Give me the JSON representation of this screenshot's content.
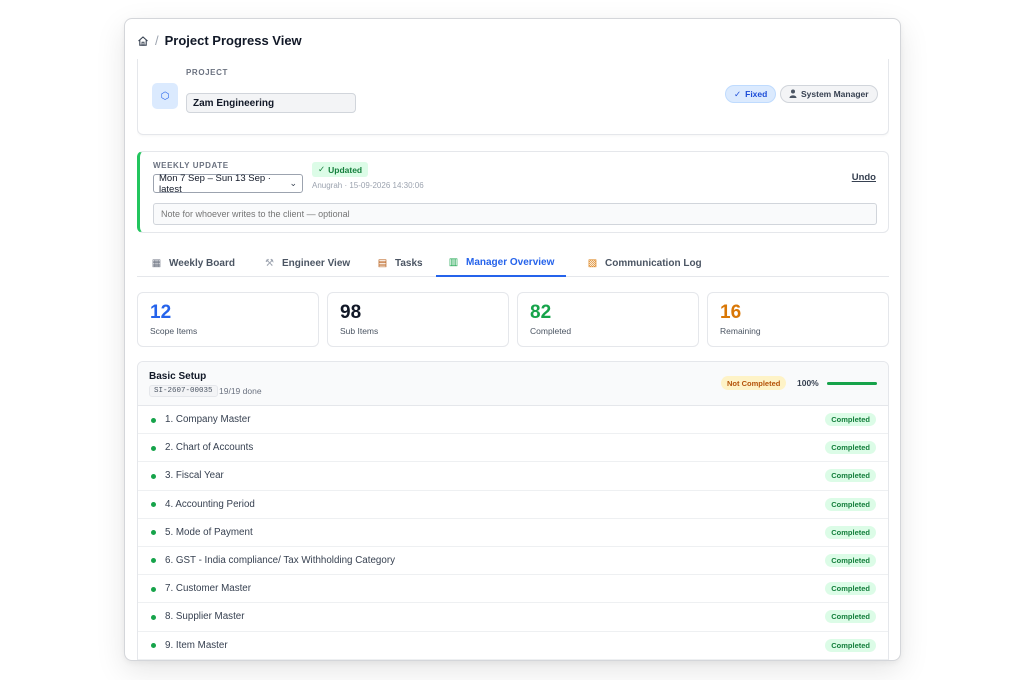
{
  "breadcrumb": {
    "separator": "/",
    "title": "Project Progress View"
  },
  "project": {
    "label": "PROJECT",
    "badge_icon": "hexagon-icon",
    "name": "Zam Engineering",
    "fixed_label": "Fixed",
    "role_label": "System Manager"
  },
  "weekly": {
    "label": "WEEKLY UPDATE",
    "selected_week": "Mon 7 Sep – Sun 13 Sep · latest",
    "status": "Updated",
    "meta": "Anugrah · 15-09-2026 14:30:06",
    "undo_label": "Undo",
    "note_placeholder": "Note for whoever writes to the client — optional"
  },
  "tabs": [
    {
      "label": "Weekly Board",
      "icon": "calendar-icon",
      "glyph": "▦"
    },
    {
      "label": "Engineer View",
      "icon": "wrench-icon",
      "glyph": "⚒"
    },
    {
      "label": "Tasks",
      "icon": "clipboard-icon",
      "glyph": "▤"
    },
    {
      "label": "Manager Overview",
      "icon": "bar-chart-icon",
      "glyph": "▥"
    },
    {
      "label": "Communication Log",
      "icon": "scroll-icon",
      "glyph": "▧"
    }
  ],
  "active_tab": "Manager Overview",
  "stats": [
    {
      "value": "12",
      "label": "Scope Items",
      "color": "#2563eb"
    },
    {
      "value": "98",
      "label": "Sub Items",
      "color": "#111827"
    },
    {
      "value": "82",
      "label": "Completed",
      "color": "#16a34a"
    },
    {
      "value": "16",
      "label": "Remaining",
      "color": "#d97706"
    }
  ],
  "section": {
    "title": "Basic Setup",
    "code": "SI-2607-00035",
    "done_text": "19/19 done",
    "status": "Not Completed",
    "percent_label": "100%",
    "progress": 1.0,
    "items": [
      {
        "label": "1. Company Master",
        "status": "Completed"
      },
      {
        "label": "2. Chart of Accounts",
        "status": "Completed"
      },
      {
        "label": "3. Fiscal Year",
        "status": "Completed"
      },
      {
        "label": "4. Accounting Period",
        "status": "Completed"
      },
      {
        "label": "5. Mode of Payment",
        "status": "Completed"
      },
      {
        "label": "6. GST - India compliance/ Tax Withholding Category",
        "status": "Completed"
      },
      {
        "label": "7. Customer Master",
        "status": "Completed"
      },
      {
        "label": "8. Supplier Master",
        "status": "Completed"
      },
      {
        "label": "9. Item Master",
        "status": "Completed"
      }
    ]
  },
  "colors": {
    "accent": "#2563eb",
    "success": "#16a34a",
    "warning": "#d97706"
  }
}
